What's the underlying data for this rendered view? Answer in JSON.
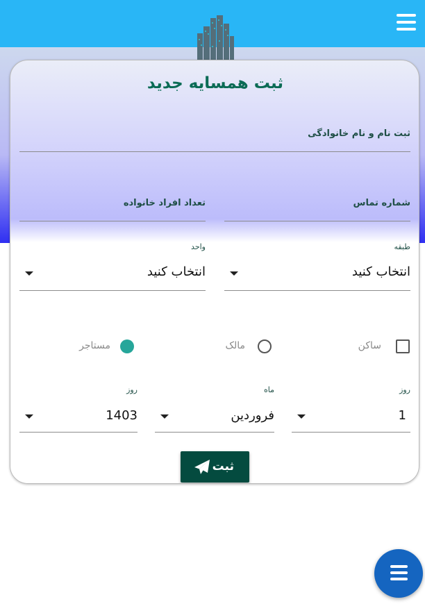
{
  "header": {
    "menu_icon": "hamburger-menu-icon",
    "logo_icon": "city-buildings-logo"
  },
  "form": {
    "title": "ثبت همسایه جدید",
    "full_name_label": "ثبت نام و نام خانوادگی",
    "phone_label": "شماره تماس",
    "family_count_label": "تعداد افراد خانواده",
    "floor_label": "طبقه",
    "floor_value": "انتخاب کنید",
    "unit_label": "واحد",
    "unit_value": "انتخاب کنید",
    "resident_label": "ساکن",
    "resident_checked": false,
    "owner_label": "مالک",
    "owner_selected": false,
    "tenant_label": "مستاجر",
    "tenant_selected": true,
    "day_label": "روز",
    "day_value": "1",
    "month_label": "ماه",
    "month_value": "فروردین",
    "year_label": "روز",
    "year_value": "1403",
    "submit_label": "ثبت",
    "submit_icon": "paper-plane-icon"
  },
  "fab": {
    "icon": "hamburger-menu-icon"
  },
  "colors": {
    "topbar": "#29b6f6",
    "title": "#0b6b55",
    "submit_bg": "#044b3f",
    "radio_selected": "#26a69a",
    "fab": "#1565c0"
  }
}
